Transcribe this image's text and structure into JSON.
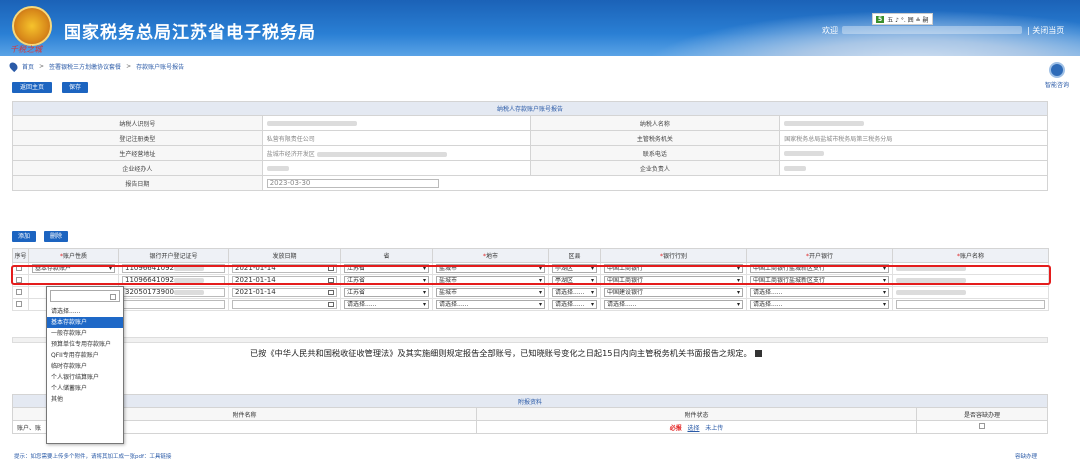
{
  "header": {
    "site_title": "国家税务总局江苏省电子税务局",
    "emblem_text": "千税之城",
    "tools_logo": "5",
    "tools_label": "五 ♪ °. 囲 ≗ 嗣",
    "welcome": "欢迎",
    "close_link": "关闭当页"
  },
  "breadcrumb": {
    "items": [
      "首页",
      "签署银税三方划缴协议套餐",
      "存款账户账号报告"
    ]
  },
  "assistant_label": "智能咨询",
  "toolbar": {
    "back_label": "返回主页",
    "save_label": "保存"
  },
  "info": {
    "title": "纳税人存款账户账号报告",
    "rows": [
      {
        "l1": "纳税人识别号",
        "v1": "",
        "l2": "纳税人名称",
        "v2": ""
      },
      {
        "l1": "登记注册类型",
        "v1": "私营有限责任公司",
        "l2": "主管税务机关",
        "v2": "国家税务总局盐城市税务局第三税务分局"
      },
      {
        "l1": "生产经营地址",
        "v1": "盐城市经济开发区",
        "l2": "联系电话",
        "v2": ""
      },
      {
        "l1": "企业经办人",
        "v1": "",
        "l2": "企业负责人",
        "v2": ""
      }
    ],
    "date_label": "报告日期",
    "date_value": "2023-03-30"
  },
  "list_toolbar": {
    "add_label": "添加",
    "delete_label": "删除"
  },
  "grid": {
    "headers": [
      {
        "text": "序号",
        "req": ""
      },
      {
        "text": "账户性质",
        "req": "*"
      },
      {
        "text": "银行开户登记证号",
        "req": ""
      },
      {
        "text": "发放日期",
        "req": ""
      },
      {
        "text": "省",
        "req": ""
      },
      {
        "text": "地市",
        "req": "*"
      },
      {
        "text": "区县",
        "req": ""
      },
      {
        "text": "银行行别",
        "req": "*"
      },
      {
        "text": "开户银行",
        "req": "*"
      },
      {
        "text": "账户名称",
        "req": "*"
      }
    ],
    "rows": [
      {
        "type": "基本存款账户",
        "reg": "11096641092",
        "date": "2021-01-14",
        "prov": "江苏省",
        "city": "盐城市",
        "county": "亭湖区",
        "bank": "中国工商银行",
        "branch": "中国工商银行盐城新区支行"
      },
      {
        "type": "",
        "reg": "11096641092",
        "date": "2021-01-14",
        "prov": "江苏省",
        "city": "盐城市",
        "county": "亭湖区",
        "bank": "中国工商银行",
        "branch": "中国工商银行盐城新区支行"
      },
      {
        "type": "",
        "reg": "32050173900",
        "date": "2021-01-14",
        "prov": "江苏省",
        "city": "盐城市",
        "county": "请选择......",
        "bank": "中国建设银行",
        "branch": "请选择......"
      },
      {
        "type": "",
        "reg": "",
        "date": "",
        "prov": "请选择......",
        "city": "请选择......",
        "county": "请选择......",
        "bank": "请选择......",
        "branch": "请选择......"
      }
    ]
  },
  "dropdown": {
    "options": [
      "请选择......",
      "基本存款账户",
      "一般存款账户",
      "预算单位专用存款账户",
      "QFII专用存款账户",
      "临时存款账户",
      "个人银行结算账户",
      "个人储蓄账户",
      "其他"
    ],
    "selected_index": 1
  },
  "declaration": "已按《中华人民共和国税收征收管理法》及其实施细则规定报告全部账号，已知晓账号变化之日起15日内向主管税务机关书面报告之规定。",
  "attachments": {
    "title": "附报资料",
    "col_name": "附件名称",
    "col_status": "附件状态",
    "col_optional": "是否容缺办理",
    "row_name": "账户、账",
    "must": "必报",
    "select": "选择",
    "upload_status": "未上传"
  },
  "tip": "提示：如您需要上传多个附件，请将其加工成一张pdf：工具链接",
  "tip_right": "容缺办理"
}
